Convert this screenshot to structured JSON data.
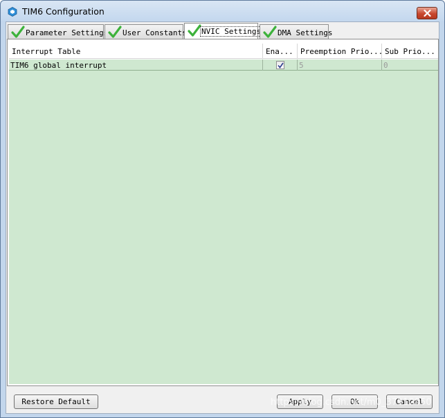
{
  "window": {
    "title": "TIM6 Configuration",
    "app_icon": "hexagon-icon",
    "close_icon": "close-icon"
  },
  "tabs": [
    {
      "label": "Parameter Settings",
      "icon": "checkmark-icon",
      "active": false
    },
    {
      "label": "User Constants",
      "icon": "checkmark-icon",
      "active": false
    },
    {
      "label": "NVIC Settings",
      "icon": "checkmark-icon",
      "active": true
    },
    {
      "label": "DMA Settings",
      "icon": "checkmark-icon",
      "active": false
    }
  ],
  "table": {
    "columns": [
      "Interrupt Table",
      "Ena...",
      "Preemption Prio...",
      "Sub Prio..."
    ],
    "rows": [
      {
        "name": "TIM6 global interrupt",
        "enabled": true,
        "preemption": "5",
        "sub": "0"
      }
    ]
  },
  "buttons": {
    "restore_default": "Restore Default",
    "apply": "Apply",
    "ok": "Ok",
    "cancel": "Cancel"
  },
  "watermark": "https://blog.csdn.net/m0_37912850",
  "colors": {
    "row_bg": "#cfe8d0",
    "check_green": "#3db23b",
    "close_red": "#c8472e"
  }
}
